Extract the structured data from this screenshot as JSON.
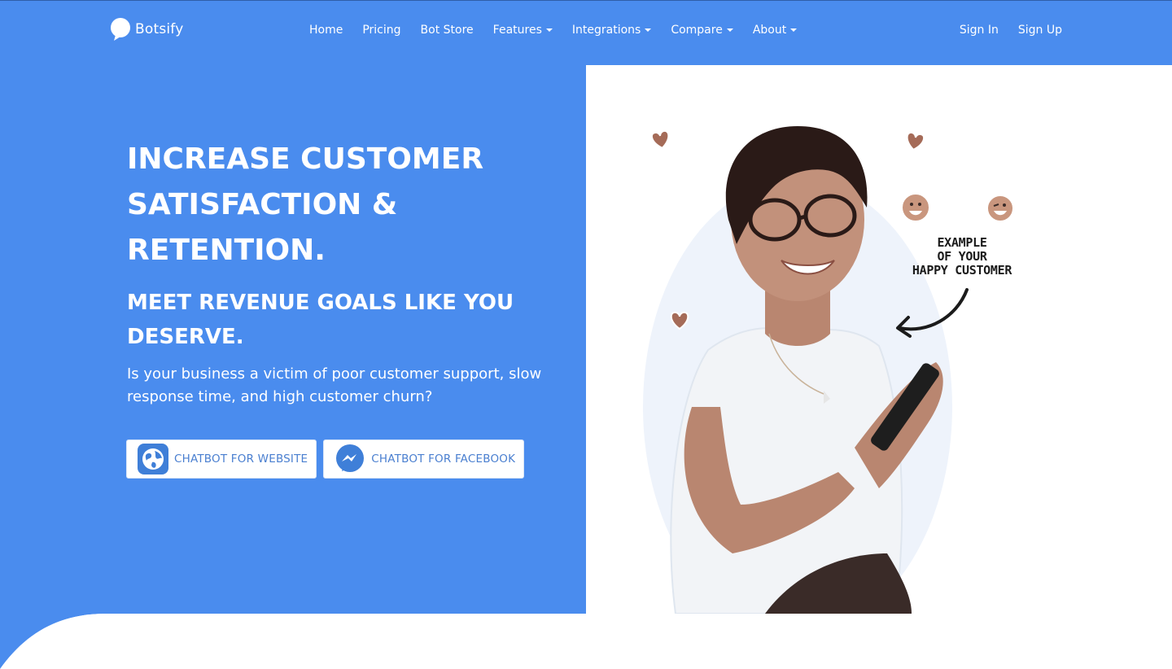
{
  "brand": {
    "name": "Botsify",
    "logo_icon": "speech-bubble-logo"
  },
  "nav": {
    "items": [
      {
        "label": "Home",
        "dropdown": false
      },
      {
        "label": "Pricing",
        "dropdown": false
      },
      {
        "label": "Bot Store",
        "dropdown": false
      },
      {
        "label": "Features",
        "dropdown": true
      },
      {
        "label": "Integrations",
        "dropdown": true
      },
      {
        "label": "Compare",
        "dropdown": true
      },
      {
        "label": "About",
        "dropdown": true
      }
    ],
    "sign_in": "Sign In",
    "sign_up": "Sign Up"
  },
  "hero": {
    "headline": "INCREASE CUSTOMER SATISFACTION & RETENTION.",
    "subheadline": "MEET REVENUE GOALS LIKE YOU DESERVE.",
    "description": "Is your business a victim of poor customer support, slow response time, and high customer churn?",
    "cta_website": {
      "label": "CHATBOT FOR WEBSITE",
      "icon": "globe-icon"
    },
    "cta_facebook": {
      "label": "CHATBOT FOR FACEBOOK",
      "icon": "messenger-icon"
    }
  },
  "illustration": {
    "note_lines": [
      "EXAMPLE",
      "OF YOUR",
      "HAPPY CUSTOMER"
    ],
    "icons": [
      "heart-icon",
      "heart-icon",
      "heart-icon",
      "smiley-icon",
      "smiley-icon",
      "arrow-icon"
    ]
  },
  "colors": {
    "primary_blue": "#4a8cee",
    "cta_text": "#4a7fd0",
    "white": "#ffffff"
  }
}
